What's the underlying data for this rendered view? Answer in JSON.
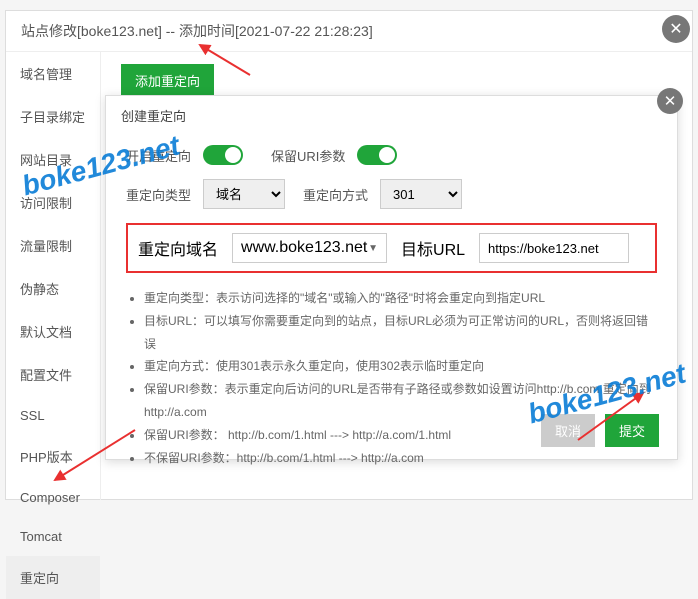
{
  "outer_modal": {
    "title": "站点修改[boke123.net] -- 添加时间[2021-07-22 21:28:23]"
  },
  "sidebar": {
    "items": [
      {
        "label": "域名管理"
      },
      {
        "label": "子目录绑定"
      },
      {
        "label": "网站目录"
      },
      {
        "label": "访问限制"
      },
      {
        "label": "流量限制"
      },
      {
        "label": "伪静态"
      },
      {
        "label": "默认文档"
      },
      {
        "label": "配置文件"
      },
      {
        "label": "SSL"
      },
      {
        "label": "PHP版本"
      },
      {
        "label": "Composer"
      },
      {
        "label": "Tomcat"
      },
      {
        "label": "重定向"
      }
    ]
  },
  "content": {
    "add_button": "添加重定向"
  },
  "inner_modal": {
    "title": "创建重定向",
    "enable_label": "开启重定向",
    "keep_uri_label": "保留URI参数",
    "type_label": "重定向类型",
    "type_value": "域名",
    "method_label": "重定向方式",
    "method_value": "301",
    "domain_label": "重定向域名",
    "domain_value": "www.boke123.net",
    "target_label": "目标URL",
    "target_value": "https://boke123.net",
    "notes": [
      "重定向类型：表示访问选择的\"域名\"或输入的\"路径\"时将会重定向到指定URL",
      "目标URL：可以填写你需要重定向到的站点，目标URL必须为可正常访问的URL，否则将返回错误",
      "重定向方式：使用301表示永久重定向，使用302表示临时重定向",
      "保留URI参数：表示重定向后访问的URL是否带有子路径或参数如设置访问http://b.com 重定向到http://a.com",
      "保留URI参数： http://b.com/1.html ---> http://a.com/1.html",
      "不保留URI参数：http://b.com/1.html ---> http://a.com"
    ],
    "cancel": "取消",
    "submit": "提交"
  },
  "watermark": "boke123.net"
}
